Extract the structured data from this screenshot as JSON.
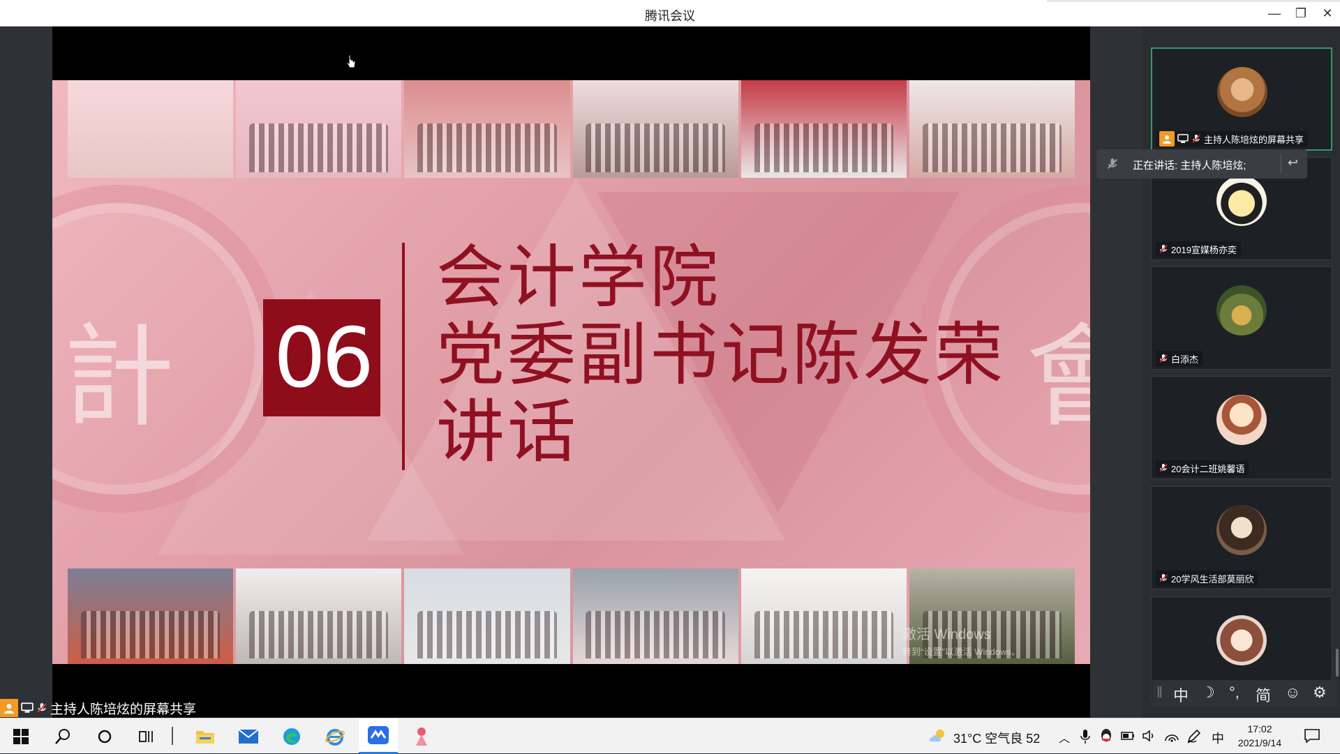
{
  "window": {
    "title": "腾讯会议",
    "buttons": {
      "minimize": "—",
      "restore": "❐",
      "close": "✕"
    }
  },
  "slide": {
    "number": "06",
    "lines": [
      "会计学院",
      "党委副书记陈发荣",
      "讲话"
    ],
    "seal_left_glyph": "計",
    "seal_right_glyph": "會"
  },
  "watermark": {
    "line1": "激活 Windows",
    "line2": "转到“设置”以激活 Windows。"
  },
  "participants": [
    {
      "name": "主持人陈培炫的屏幕共享",
      "host": true,
      "avatar_icon": "cat-avatar-icon"
    },
    {
      "name": "2019宣媒杨亦奕",
      "host": false,
      "avatar_icon": "cartoon-avatar-icon"
    },
    {
      "name": "白添杰",
      "host": false,
      "avatar_icon": "nature-avatar-icon"
    },
    {
      "name": "20会计二班姚馨语",
      "host": false,
      "avatar_icon": "girl-avatar-icon"
    },
    {
      "name": "20学风生活部莫丽欣",
      "host": false,
      "avatar_icon": "woman-avatar-icon"
    },
    {
      "name": "",
      "host": false,
      "avatar_icon": "anime-avatar-icon"
    }
  ],
  "speaking_popup": {
    "text": "正在讲话: 主持人陈培炫;"
  },
  "share_label": "主持人陈培炫的屏幕共享",
  "ime": {
    "lang": "中",
    "moon": "☽",
    "punct": "°,",
    "simplified": "简",
    "emoji": "☺",
    "settings": "⚙"
  },
  "tray": {
    "weather": "31°C 空气良 52",
    "ime": "中",
    "time": "17:02",
    "date": "2021/9/14"
  },
  "colors": {
    "accent_red": "#8f1121",
    "host_orange": "#f39a27",
    "active_green": "#2f9b69",
    "taskbar_blue": "#2b7ad8"
  }
}
